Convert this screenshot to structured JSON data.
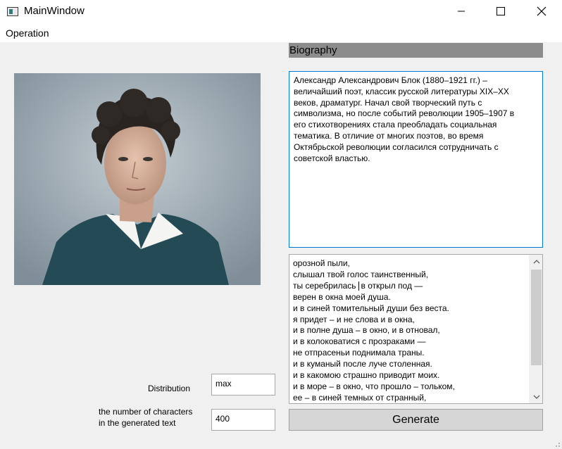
{
  "window": {
    "title": "MainWindow",
    "minimize_icon": "minimize-icon",
    "maximize_icon": "maximize-icon",
    "close_icon": "close-icon"
  },
  "menu": {
    "operation_label": "Operation"
  },
  "portrait": {
    "icon": "portrait-photo"
  },
  "biography": {
    "header": "Biography",
    "text": "Александр Александрович Блок (1880–1921 гг.) –\nвеличайший поэт, классик русской литературы XIX–XX\nвеков, драматург. Начал свой творческий путь с\nсимволизма, но после событий революции 1905–1907 в\nего стихотворениях стала преобладать социальная\nтематика. В отличие от многих поэтов, во время\nОктябрьской революции согласился сотрудничать с\nсоветской властью."
  },
  "generated": {
    "lines": [
      "орозной пыли,",
      "слышал твой голос таинственный,",
      "ты серебрилась",
      "верен в окна моей душа.",
      "и в синей томительный души без веста.",
      "я придет – и не слова и в окна,",
      "и в полне душа – в окно, и в отновал,",
      "и в колоковатися с прозраками —",
      "не отпрасеньи поднимала траны.",
      "и в куманый после луче столенная.",
      "и в какомою страшно приводит моих.",
      "и в море – в окно, что прошло – тольком,",
      "ее – в синей темных от странный,"
    ],
    "line3_after_caret": "в открыл под —",
    "scroll_up_icon": "chevron-up-icon",
    "scroll_down_icon": "chevron-down-icon",
    "scroll_position": 0.0
  },
  "controls": {
    "distribution_label": "Distribution",
    "distribution_value": "max",
    "chars_label_line1": "the number of characters",
    "chars_label_line2": "in the generated text",
    "chars_value": "400",
    "generate_label": "Generate"
  },
  "colors": {
    "accent_border": "#0078d7",
    "header_bg": "#8c8c8c"
  }
}
